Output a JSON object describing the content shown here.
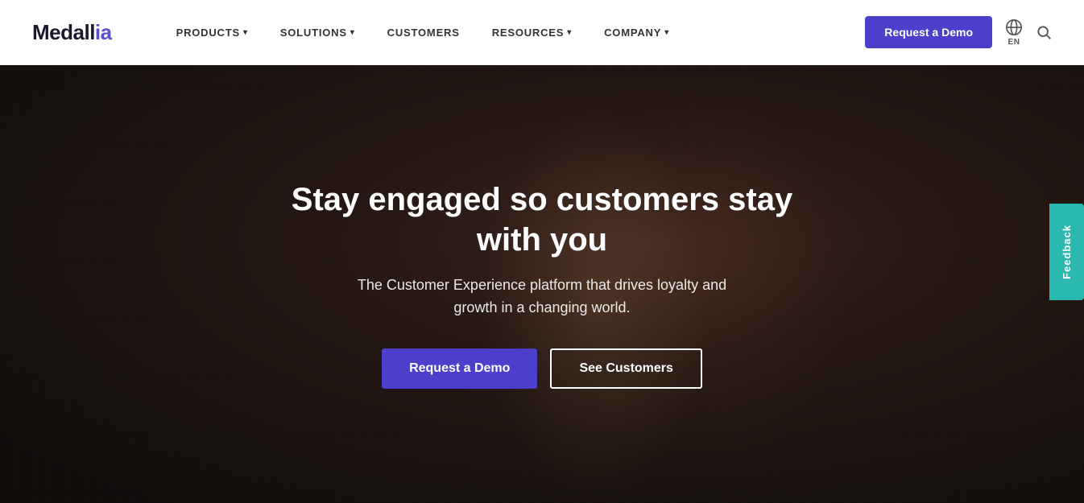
{
  "brand": {
    "logo_text": "Medall",
    "logo_highlight": "ia"
  },
  "navbar": {
    "items": [
      {
        "label": "PRODUCTS",
        "has_dropdown": true
      },
      {
        "label": "SOLUTIONS",
        "has_dropdown": true
      },
      {
        "label": "CUSTOMERS",
        "has_dropdown": false
      },
      {
        "label": "RESOURCES",
        "has_dropdown": true
      },
      {
        "label": "COMPANY",
        "has_dropdown": true
      }
    ],
    "cta_label": "Request a Demo",
    "lang_label": "EN",
    "search_icon": "🔍"
  },
  "hero": {
    "title": "Stay engaged so customers stay with you",
    "subtitle": "The Customer Experience platform that drives loyalty and\ngrowth in a changing world.",
    "btn_primary": "Request a Demo",
    "btn_secondary": "See Customers"
  },
  "feedback": {
    "label": "Feedback"
  }
}
